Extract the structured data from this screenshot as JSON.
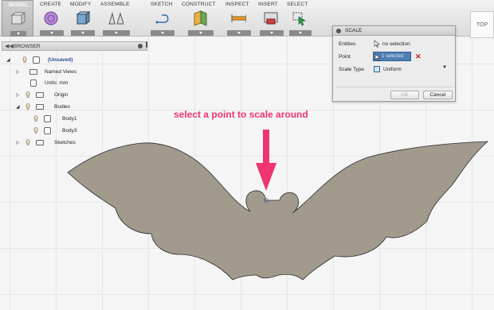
{
  "toolbar": {
    "model_label": "MODEL",
    "groups": [
      {
        "label": "CREATE",
        "icon": "sphere-icon"
      },
      {
        "label": "MODIFY",
        "icon": "modify-icon"
      },
      {
        "label": "ASSEMBLE",
        "icon": "joint-icon"
      },
      {
        "label": "SKETCH",
        "icon": "sketch-icon"
      },
      {
        "label": "CONSTRUCT",
        "icon": "plane-icon"
      },
      {
        "label": "INSPECT",
        "icon": "measure-icon"
      },
      {
        "label": "INSERT",
        "icon": "insert-icon"
      },
      {
        "label": "SELECT",
        "icon": "select-cursor-icon"
      }
    ]
  },
  "view_cube": {
    "label": "TOP"
  },
  "browser": {
    "title": "BROWSER",
    "root_label": "(Unsaved)",
    "items": [
      {
        "label": "Named Views"
      },
      {
        "label": "Units: mm"
      },
      {
        "label": "Origin"
      },
      {
        "label": "Bodies"
      },
      {
        "label": "Body1"
      },
      {
        "label": "Body3"
      },
      {
        "label": "Sketches"
      }
    ]
  },
  "scale_dialog": {
    "title": "SCALE",
    "entities_label": "Entities",
    "entities_value": "no selection",
    "point_label": "Point",
    "point_value": "1 selected",
    "scale_type_label": "Scale Type",
    "scale_type_value": "Uniform",
    "ok_label": "OK",
    "cancel_label": "Cancel"
  },
  "annotation": {
    "text": "select a point to scale around",
    "color": "#ef3470"
  },
  "colors": {
    "bat_fill": "#a19a8c",
    "selection_blue": "#4f7fb5",
    "clear_red": "#c0202a"
  }
}
